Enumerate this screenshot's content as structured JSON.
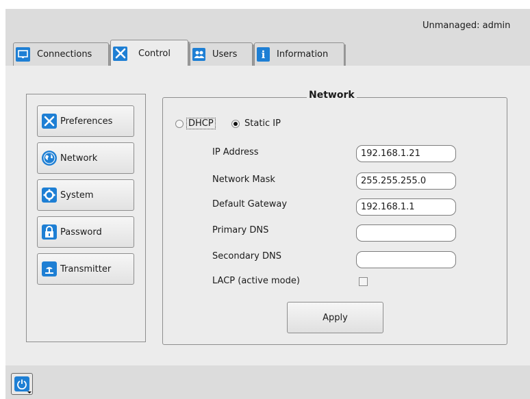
{
  "header": {
    "user_label": "Unmanaged: admin"
  },
  "tabs": [
    {
      "label": "Connections",
      "icon": "monitor-icon"
    },
    {
      "label": "Control",
      "icon": "tools-icon",
      "active": true
    },
    {
      "label": "Users",
      "icon": "users-icon"
    },
    {
      "label": "Information",
      "icon": "info-icon"
    }
  ],
  "sidebar": {
    "items": [
      {
        "label": "Preferences",
        "icon": "tools-icon"
      },
      {
        "label": "Network",
        "icon": "globe-icon"
      },
      {
        "label": "System",
        "icon": "gear-icon"
      },
      {
        "label": "Password",
        "icon": "lock-icon"
      },
      {
        "label": "Transmitter",
        "icon": "transmitter-icon"
      }
    ]
  },
  "network": {
    "title": "Network",
    "mode_options": {
      "dhcp": "DHCP",
      "static": "Static IP",
      "selected": "Static IP"
    },
    "fields": {
      "ip_address": {
        "label": "IP Address",
        "value": "192.168.1.21"
      },
      "network_mask": {
        "label": "Network Mask",
        "value": "255.255.255.0"
      },
      "default_gateway": {
        "label": "Default Gateway",
        "value": "192.168.1.1"
      },
      "primary_dns": {
        "label": "Primary DNS",
        "value": ""
      },
      "secondary_dns": {
        "label": "Secondary DNS",
        "value": ""
      }
    },
    "lacp": {
      "label": "LACP (active mode)",
      "checked": false
    },
    "apply_label": "Apply"
  },
  "footer": {
    "power_icon": "power-icon"
  },
  "colors": {
    "accent": "#1e7fd4",
    "background": "#dcdcdc",
    "panel": "#ececec"
  }
}
